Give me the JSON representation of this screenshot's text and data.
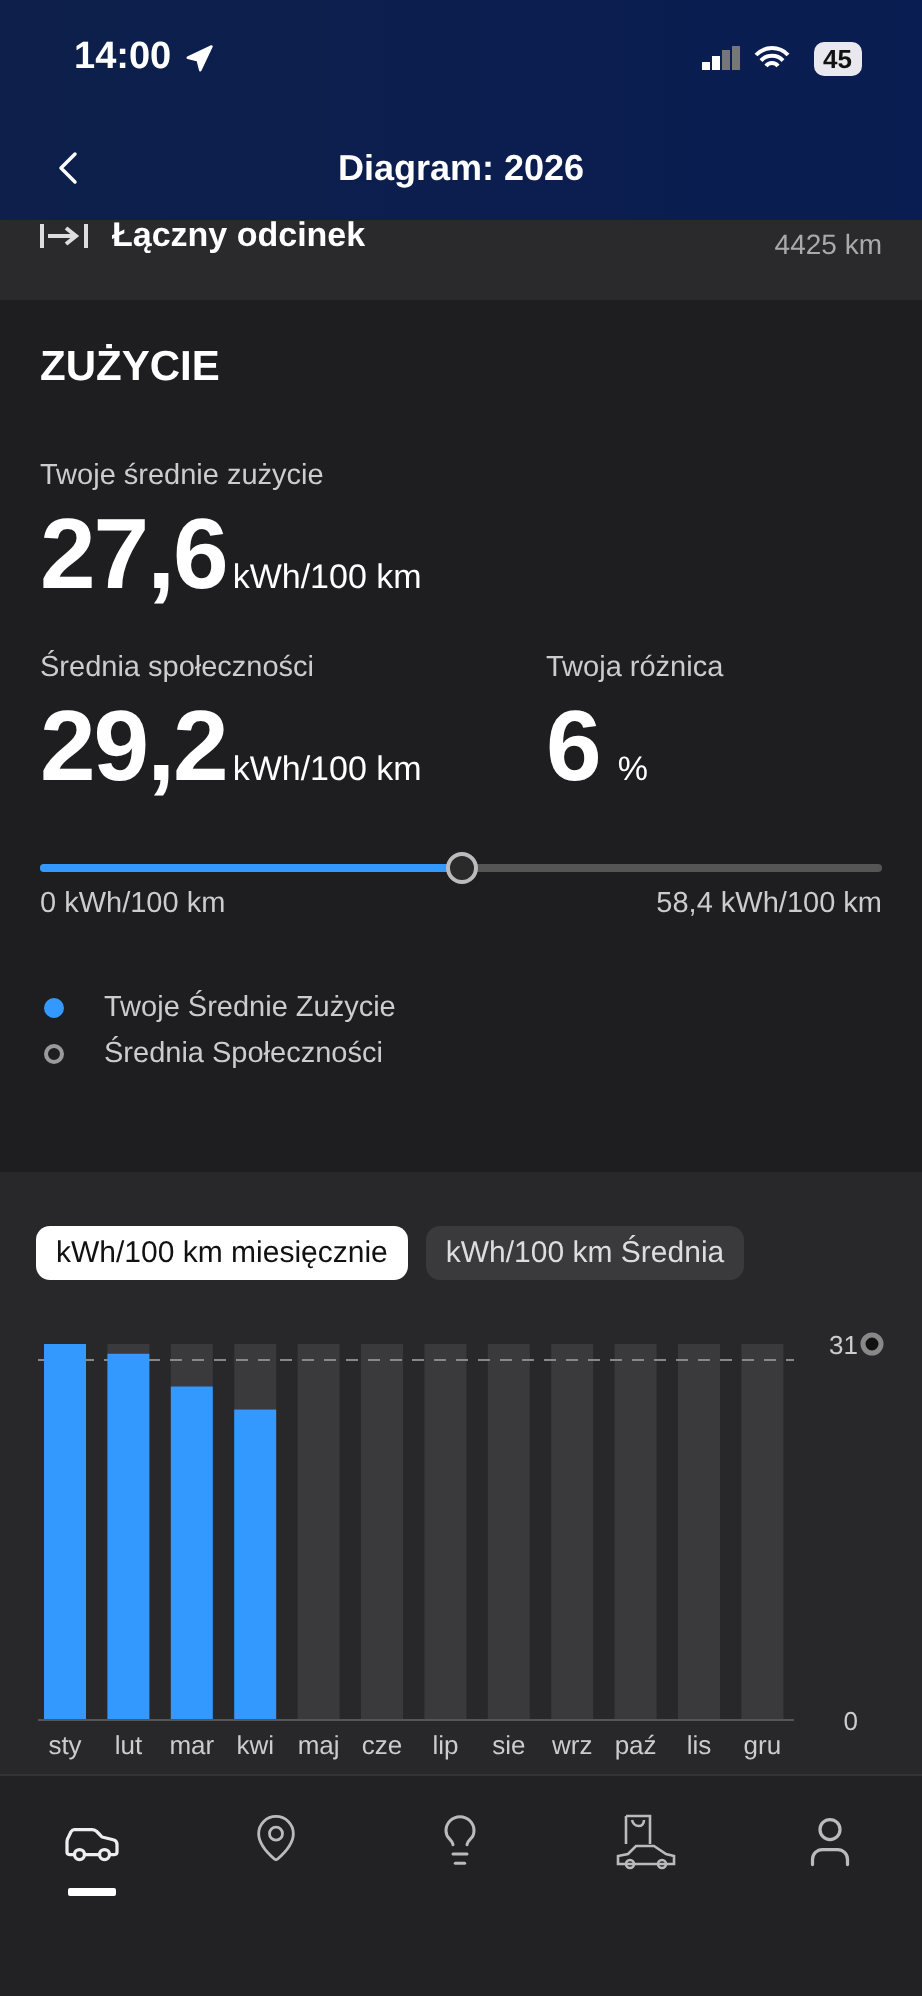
{
  "status_bar": {
    "time": "14:00",
    "battery": "45"
  },
  "nav": {
    "title": "Diagram: 2026"
  },
  "total_row": {
    "label": "Łączny odcinek",
    "value": "4425 km"
  },
  "consumption": {
    "title": "ZUŻYCIE",
    "yours": {
      "label": "Twoje średnie zużycie",
      "value": "27,6",
      "unit": "kWh/100 km"
    },
    "community": {
      "label": "Średnia społeczności",
      "value": "29,2",
      "unit": "kWh/100 km"
    },
    "difference": {
      "label": "Twoja różnica",
      "value": "6",
      "unit": "%"
    },
    "slider": {
      "level": 0.5,
      "min_label": "0 kWh/100 km",
      "max_label": "58,4 kWh/100 km"
    },
    "legend": [
      {
        "kind": "filled",
        "label": "Twoje Średnie Zużycie",
        "color": "#3399ff"
      },
      {
        "kind": "ring",
        "label": "Średnia Społeczności",
        "color": "#9a9a9a"
      }
    ]
  },
  "chart_tabs": [
    {
      "label": "kWh/100 km miesięcznie",
      "selected": true
    },
    {
      "label": "kWh/100 km Średnia",
      "selected": false
    }
  ],
  "chart_data": {
    "type": "bar",
    "categories": [
      "sty",
      "lut",
      "mar",
      "kwi",
      "maj",
      "cze",
      "lip",
      "sie",
      "wrz",
      "paź",
      "lis",
      "gru"
    ],
    "series": [
      {
        "color": "#3399ff",
        "values": [
          31,
          30.2,
          27.5,
          25.6,
          null,
          null,
          null,
          null,
          null,
          null,
          null,
          null
        ]
      }
    ],
    "ylim": [
      0,
      31
    ],
    "yticks": [
      0,
      31
    ]
  },
  "bottom_nav": [
    {
      "kind": "car",
      "selected": true
    },
    {
      "kind": "pin",
      "selected": false
    },
    {
      "kind": "bulb",
      "selected": false
    },
    {
      "kind": "shop",
      "selected": false
    },
    {
      "kind": "user",
      "selected": false
    }
  ]
}
